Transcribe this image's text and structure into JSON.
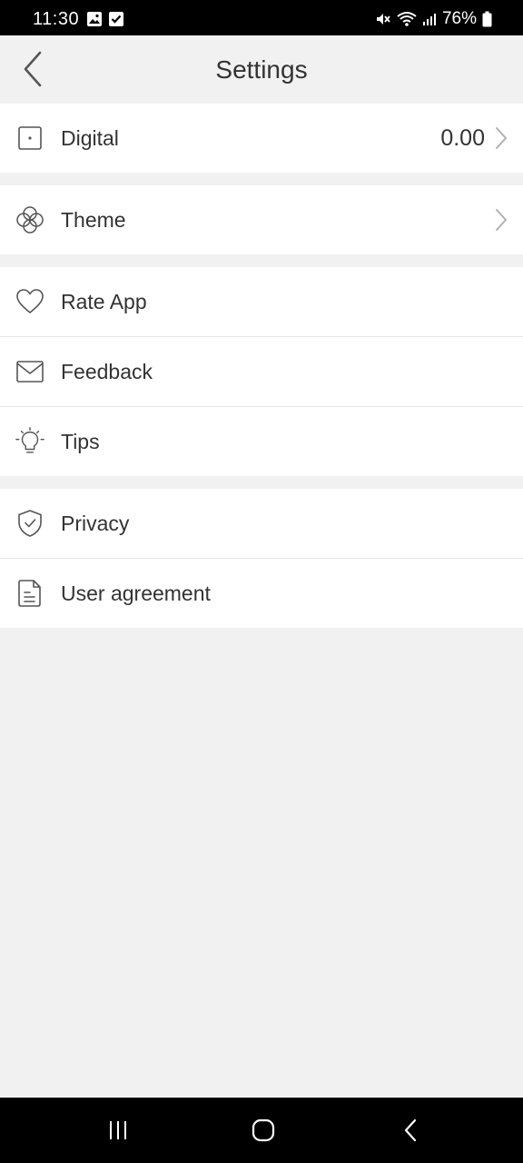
{
  "status_bar": {
    "time": "11:30",
    "battery": "76%"
  },
  "header": {
    "title": "Settings"
  },
  "groups": [
    {
      "items": [
        {
          "label": "Digital",
          "value": "0.00",
          "icon": "square-dot-icon",
          "has_chevron": true
        }
      ]
    },
    {
      "items": [
        {
          "label": "Theme",
          "icon": "flower-icon",
          "has_chevron": true
        }
      ]
    },
    {
      "items": [
        {
          "label": "Rate App",
          "icon": "heart-icon"
        },
        {
          "label": "Feedback",
          "icon": "envelope-icon"
        },
        {
          "label": "Tips",
          "icon": "lightbulb-icon"
        }
      ]
    },
    {
      "items": [
        {
          "label": "Privacy",
          "icon": "shield-check-icon"
        },
        {
          "label": "User agreement",
          "icon": "document-icon"
        }
      ]
    }
  ],
  "colors": {
    "background": "#f1f1f1",
    "row_background": "#ffffff",
    "text": "#333333",
    "icon_stroke": "#555555",
    "chevron": "#b0b0b0",
    "bar_background": "#000000"
  }
}
